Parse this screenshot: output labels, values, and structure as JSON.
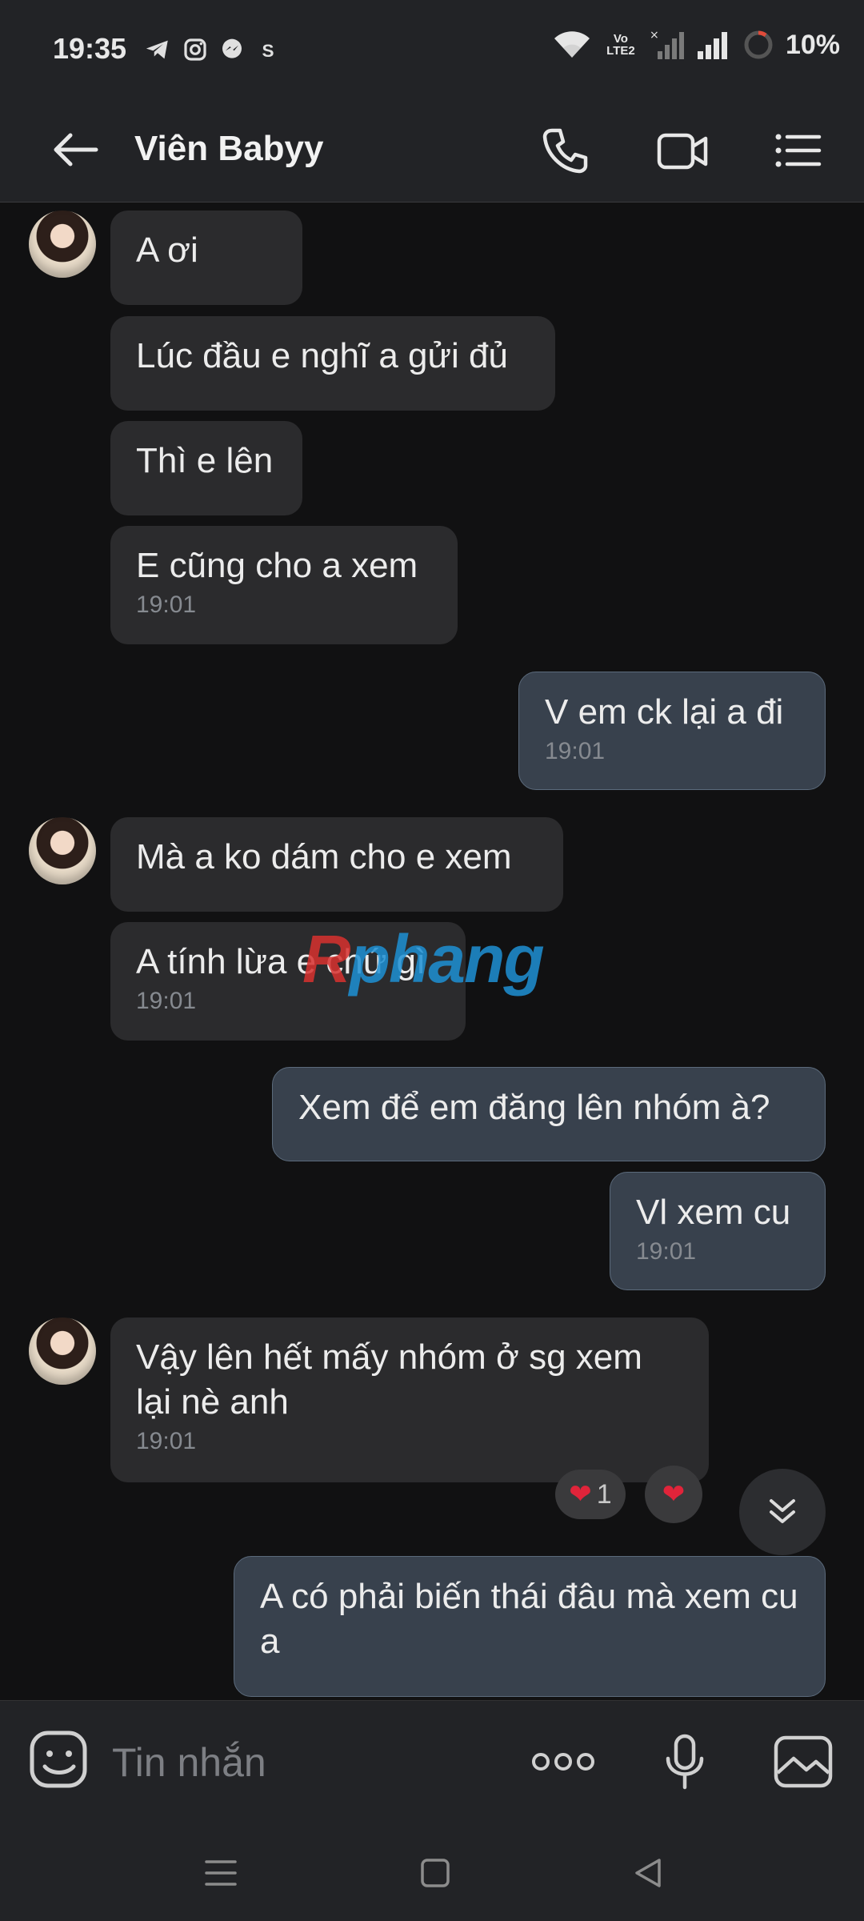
{
  "status_bar": {
    "time": "19:35",
    "left_icons": [
      "telegram-icon",
      "instagram-icon",
      "messenger-icon",
      "skype-icon"
    ],
    "network": "Vo LTE2",
    "battery": "10%"
  },
  "header": {
    "title": "Viên Babyy",
    "icons": [
      "back-arrow-icon",
      "phone-icon",
      "video-call-icon",
      "menu-list-icon"
    ]
  },
  "messages": [
    {
      "dir": "in",
      "text": "A ơi",
      "time": ""
    },
    {
      "dir": "in",
      "text": "Lúc đầu e nghĩ a gửi đủ",
      "time": ""
    },
    {
      "dir": "in",
      "text": "Thì e lên",
      "time": ""
    },
    {
      "dir": "in",
      "text": "E cũng cho a xem",
      "time": "19:01"
    },
    {
      "dir": "out",
      "text": "V em ck lại a đi",
      "time": "19:01"
    },
    {
      "dir": "in",
      "text": "Mà a ko dám cho e xem",
      "time": ""
    },
    {
      "dir": "in",
      "text": "A tính lừa e chứ gì",
      "time": "19:01"
    },
    {
      "dir": "out",
      "text": "Xem để em đăng lên nhóm à?",
      "time": ""
    },
    {
      "dir": "out",
      "text": "Vl xem cu",
      "time": "19:01"
    },
    {
      "dir": "in",
      "text": "Vậy lên hết mấy nhóm ở sg xem lại nè anh",
      "time": "19:01"
    },
    {
      "dir": "out",
      "text": "A có phải biến thái đâu mà xem cu a",
      "time": ""
    }
  ],
  "reactions": {
    "count": "1"
  },
  "watermark": {
    "r": "R",
    "rest": "phang"
  },
  "input": {
    "placeholder": "Tin nhắn"
  },
  "colors": {
    "incoming": "#2b2b2d",
    "outgoing": "#38414d",
    "background": "#111112",
    "bar": "#222326"
  }
}
